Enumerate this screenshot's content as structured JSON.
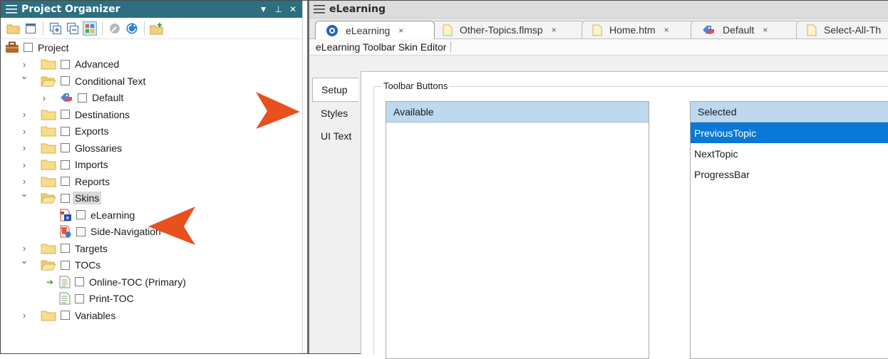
{
  "left_pane": {
    "title": "Project Organizer",
    "controls": [
      "▼",
      "⊥",
      "✕"
    ],
    "toolbar_icons": [
      "open-folder-icon",
      "list-view-icon",
      "expand-all-icon",
      "collapse-all-icon",
      "grid-view-icon",
      "tool-icon",
      "globe-icon",
      "new-folder-icon"
    ],
    "tree": [
      {
        "label": "Project",
        "icon": "project-icon",
        "depth": 0,
        "expander": "",
        "checkbox": true
      },
      {
        "label": "Advanced",
        "icon": "folder-icon",
        "depth": 1,
        "expander": "›",
        "checkbox": true
      },
      {
        "label": "Conditional Text",
        "icon": "folder-open-icon",
        "depth": 1,
        "expander": "⌄",
        "checkbox": true
      },
      {
        "label": "Default",
        "icon": "condition-tag-icon",
        "depth": 2,
        "expander": "›",
        "checkbox": true
      },
      {
        "label": "Destinations",
        "icon": "folder-icon",
        "depth": 1,
        "expander": "›",
        "checkbox": true
      },
      {
        "label": "Exports",
        "icon": "folder-icon",
        "depth": 1,
        "expander": "›",
        "checkbox": true
      },
      {
        "label": "Glossaries",
        "icon": "folder-icon",
        "depth": 1,
        "expander": "›",
        "checkbox": true
      },
      {
        "label": "Imports",
        "icon": "folder-icon",
        "depth": 1,
        "expander": "›",
        "checkbox": true
      },
      {
        "label": "Reports",
        "icon": "folder-icon",
        "depth": 1,
        "expander": "›",
        "checkbox": true
      },
      {
        "label": "Skins",
        "icon": "folder-open-icon",
        "depth": 1,
        "expander": "⌄",
        "checkbox": true,
        "highlight": true
      },
      {
        "label": "eLearning",
        "icon": "elearning-skin-icon",
        "depth": 2,
        "expander": "",
        "checkbox": true
      },
      {
        "label": "Side-Navigation",
        "icon": "html5-skin-icon",
        "depth": 2,
        "expander": "",
        "checkbox": true
      },
      {
        "label": "Targets",
        "icon": "folder-icon",
        "depth": 1,
        "expander": "›",
        "checkbox": true
      },
      {
        "label": "TOCs",
        "icon": "folder-open-icon",
        "depth": 1,
        "expander": "⌄",
        "checkbox": true
      },
      {
        "label": "Online-TOC (Primary)",
        "icon": "toc-file-icon",
        "depth": 2,
        "expander": "",
        "checkbox": true,
        "primary": true
      },
      {
        "label": "Print-TOC",
        "icon": "toc-file-icon",
        "depth": 2,
        "expander": "",
        "checkbox": true
      },
      {
        "label": "Variables",
        "icon": "folder-icon",
        "depth": 1,
        "expander": "›",
        "checkbox": true
      }
    ]
  },
  "document": {
    "title": "eLearning",
    "tabs": [
      {
        "label": "eLearning",
        "icon": "flare-icon",
        "close": "×",
        "active": true
      },
      {
        "label": "Other-Topics.flmsp",
        "icon": "file-icon",
        "close": "×"
      },
      {
        "label": "Home.htm",
        "icon": "file-icon",
        "close": "×"
      },
      {
        "label": "Default",
        "icon": "condition-tag-icon",
        "close": "×"
      },
      {
        "label": "Select-All-Th",
        "icon": "file-icon",
        "close": ""
      }
    ],
    "editor_title": "eLearning Toolbar Skin Editor",
    "side_tabs": [
      {
        "label": "Setup",
        "active": true
      },
      {
        "label": "Styles"
      },
      {
        "label": "UI Text"
      }
    ],
    "group_title": "Toolbar Buttons",
    "available": {
      "header": "Available",
      "items": []
    },
    "selected": {
      "header": "Selected",
      "items": [
        {
          "label": "PreviousTopic",
          "selected": true
        },
        {
          "label": "NextTopic"
        },
        {
          "label": "ProgressBar"
        }
      ]
    }
  },
  "colors": {
    "pane_title_bg": "#2b6f80",
    "list_header_bg": "#bcd9ef",
    "selection_bg": "#0a78d7",
    "arrow": "#e8501e"
  }
}
